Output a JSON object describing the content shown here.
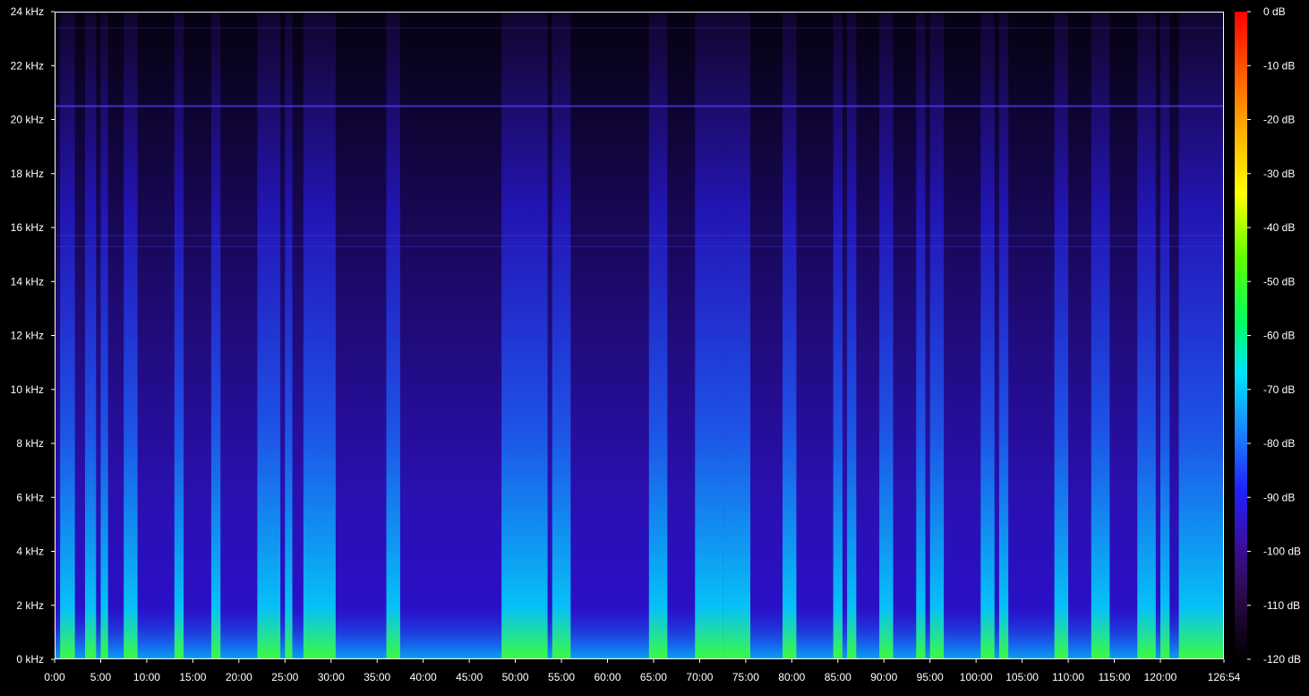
{
  "chart_data": {
    "type": "heatmap",
    "title": "",
    "xlabel": "",
    "ylabel": "",
    "x_range_minutes": [
      0,
      126.9
    ],
    "x_ticks": [
      "0:00",
      "5:00",
      "10:00",
      "15:00",
      "20:00",
      "25:00",
      "30:00",
      "35:00",
      "40:00",
      "45:00",
      "50:00",
      "55:00",
      "60:00",
      "65:00",
      "70:00",
      "75:00",
      "80:00",
      "85:00",
      "90:00",
      "95:00",
      "100:00",
      "105:00",
      "110:00",
      "115:00",
      "120:00",
      "126:54"
    ],
    "x_tick_minutes": [
      0,
      5,
      10,
      15,
      20,
      25,
      30,
      35,
      40,
      45,
      50,
      55,
      60,
      65,
      70,
      75,
      80,
      85,
      90,
      95,
      100,
      105,
      110,
      115,
      120,
      126.9
    ],
    "ylim_khz": [
      0,
      24
    ],
    "y_ticks": [
      "0 kHz",
      "2 kHz",
      "4 kHz",
      "6 kHz",
      "8 kHz",
      "10 kHz",
      "12 kHz",
      "14 kHz",
      "16 kHz",
      "18 kHz",
      "20 kHz",
      "22 kHz",
      "24 kHz"
    ],
    "y_tick_khz": [
      0,
      2,
      4,
      6,
      8,
      10,
      12,
      14,
      16,
      18,
      20,
      22,
      24
    ],
    "colorbar_range_db": [
      -120,
      0
    ],
    "colorbar_ticks": [
      "0 dB",
      "-10 dB",
      "-20 dB",
      "-30 dB",
      "-40 dB",
      "-50 dB",
      "-60 dB",
      "-70 dB",
      "-80 dB",
      "-90 dB",
      "-100 dB",
      "-110 dB",
      "-120 dB"
    ],
    "colorbar_tick_db": [
      0,
      -10,
      -20,
      -30,
      -40,
      -50,
      -60,
      -70,
      -80,
      -90,
      -100,
      -110,
      -120
    ],
    "colormap": [
      "#000000",
      "#2a0a4a",
      "#3a10a0",
      "#2020ff",
      "#1a8cff",
      "#00e0ff",
      "#00ff60",
      "#60ff00",
      "#ffff00",
      "#ff9900",
      "#ff0000"
    ],
    "colors": {
      "background": "#000000",
      "frame": "#ffffff",
      "text": "#ffffff"
    },
    "bright_segments_minutes": [
      [
        0.6,
        2.2
      ],
      [
        3.3,
        4.5
      ],
      [
        5.0,
        5.8
      ],
      [
        7.5,
        9.0
      ],
      [
        13.0,
        14.0
      ],
      [
        17.0,
        18.0
      ],
      [
        22.0,
        24.5
      ],
      [
        25.0,
        25.8
      ],
      [
        27.0,
        30.5
      ],
      [
        36.0,
        37.5
      ],
      [
        48.5,
        53.5
      ],
      [
        54.0,
        56.0
      ],
      [
        64.5,
        66.5
      ],
      [
        69.5,
        72.5
      ],
      [
        72.5,
        75.5
      ],
      [
        79.0,
        80.5
      ],
      [
        84.5,
        85.5
      ],
      [
        86.0,
        87.0
      ],
      [
        89.5,
        91.0
      ],
      [
        93.5,
        94.5
      ],
      [
        95.0,
        96.5
      ],
      [
        100.5,
        102.0
      ],
      [
        102.5,
        103.5
      ],
      [
        108.5,
        110.0
      ],
      [
        112.5,
        114.5
      ],
      [
        117.5,
        119.5
      ],
      [
        120.0,
        121.0
      ],
      [
        122.0,
        126.9
      ]
    ],
    "horizontal_lines_khz": [
      20.5,
      15.7,
      15.3,
      23.4
    ]
  }
}
